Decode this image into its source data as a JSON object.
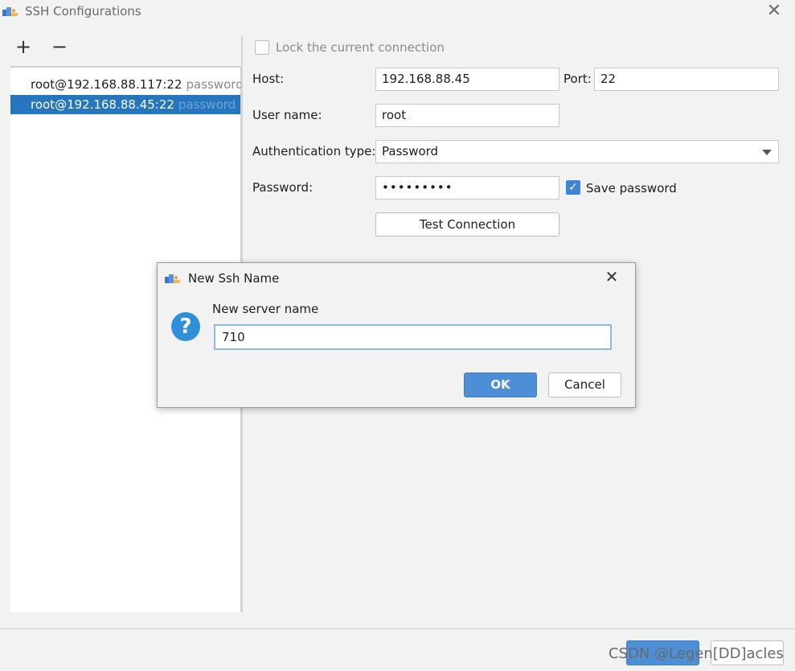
{
  "window": {
    "title": "SSH Configurations",
    "app_icon": "app-logo-icon",
    "close_icon": "close-icon",
    "close_glyph": "✕"
  },
  "toolbar": {
    "add_icon": "plus-icon",
    "add_glyph": "+",
    "remove_icon": "minus-icon",
    "remove_glyph": "−"
  },
  "connections": [
    {
      "host": "root@192.168.88.117:22",
      "auth": "password",
      "selected": false
    },
    {
      "host": "root@192.168.88.45:22",
      "auth": "password",
      "selected": true
    }
  ],
  "form": {
    "lock_label": "Lock the current connection",
    "lock_checked": false,
    "host_label": "Host:",
    "host_value": "192.168.88.45",
    "port_label": "Port:",
    "port_value": "22",
    "user_label": "User name:",
    "user_value": "root",
    "auth_label": "Authentication type:",
    "auth_value": "Password",
    "password_label": "Password:",
    "password_value": "•••••••••",
    "save_password_label": "Save password",
    "save_password_checked": true,
    "test_connection_label": "Test Connection"
  },
  "dialog": {
    "title": "New Ssh Name",
    "close_glyph": "✕",
    "question_glyph": "?",
    "prompt": "New server name",
    "input_value": "710",
    "ok_label": "OK",
    "cancel_label": "Cancel"
  },
  "footer": {
    "watermark": "CSDN @Legen[DD]acles"
  },
  "colors": {
    "selection": "#2675bf",
    "accent": "#4d8fd6",
    "background": "#f2f2f2"
  }
}
